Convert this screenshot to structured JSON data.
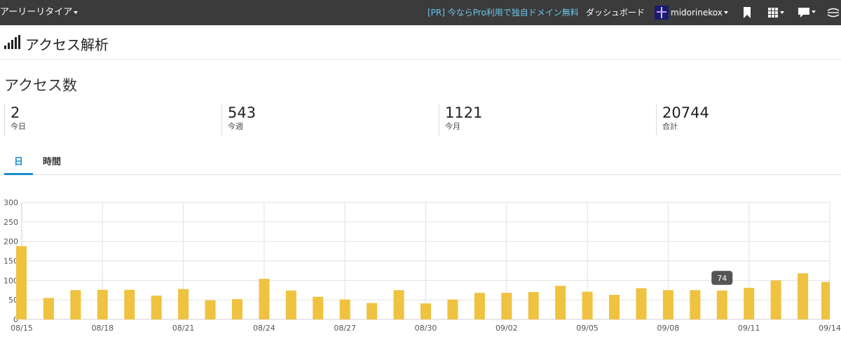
{
  "topbar": {
    "brand": "アーリーリタイア",
    "pr_link": "[PR] 今ならPro利用で独自ドメイン無料",
    "dashboard": "ダッシュボード",
    "username": "midorinekox"
  },
  "header": {
    "title": "アクセス解析"
  },
  "section": {
    "title": "アクセス数"
  },
  "stats": [
    {
      "value": "2",
      "label": "今日"
    },
    {
      "value": "543",
      "label": "今週"
    },
    {
      "value": "1121",
      "label": "今月"
    },
    {
      "value": "20744",
      "label": "合計"
    }
  ],
  "tabs": [
    {
      "label": "日"
    },
    {
      "label": "時間"
    }
  ],
  "icons": {
    "signal": "signal-bars-icon",
    "bookmark": "bookmark-icon",
    "grid": "grid-menu-icon",
    "comment": "comment-icon",
    "extra": "more-icon"
  },
  "colors": {
    "bar": "#efc23f",
    "topbar": "#3b3b3b",
    "accent": "#1a8ed0",
    "pr_link": "#6cc6ea"
  },
  "chart_data": {
    "type": "bar",
    "categories": [
      "08/15",
      "08/16",
      "08/17",
      "08/18",
      "08/19",
      "08/20",
      "08/21",
      "08/22",
      "08/23",
      "08/24",
      "08/25",
      "08/26",
      "08/27",
      "08/28",
      "08/29",
      "08/30",
      "08/31",
      "09/01",
      "09/02",
      "09/03",
      "09/04",
      "09/05",
      "09/06",
      "09/07",
      "09/08",
      "09/09",
      "09/10",
      "09/11",
      "09/12",
      "09/13",
      "09/14"
    ],
    "tick_labels": [
      "08/15",
      "08/18",
      "08/21",
      "08/24",
      "08/27",
      "08/30",
      "09/02",
      "09/05",
      "09/08",
      "09/11",
      "09/14"
    ],
    "values": [
      188,
      55,
      75,
      76,
      76,
      61,
      78,
      49,
      52,
      104,
      74,
      58,
      51,
      42,
      75,
      41,
      51,
      68,
      68,
      70,
      86,
      71,
      63,
      80,
      75,
      75,
      74,
      81,
      100,
      118,
      96
    ],
    "ylim": [
      0,
      300
    ],
    "yticks": [
      0,
      50,
      100,
      150,
      200,
      250,
      300
    ],
    "grid": true,
    "tooltip": {
      "category": "09/10",
      "value": "74"
    }
  }
}
